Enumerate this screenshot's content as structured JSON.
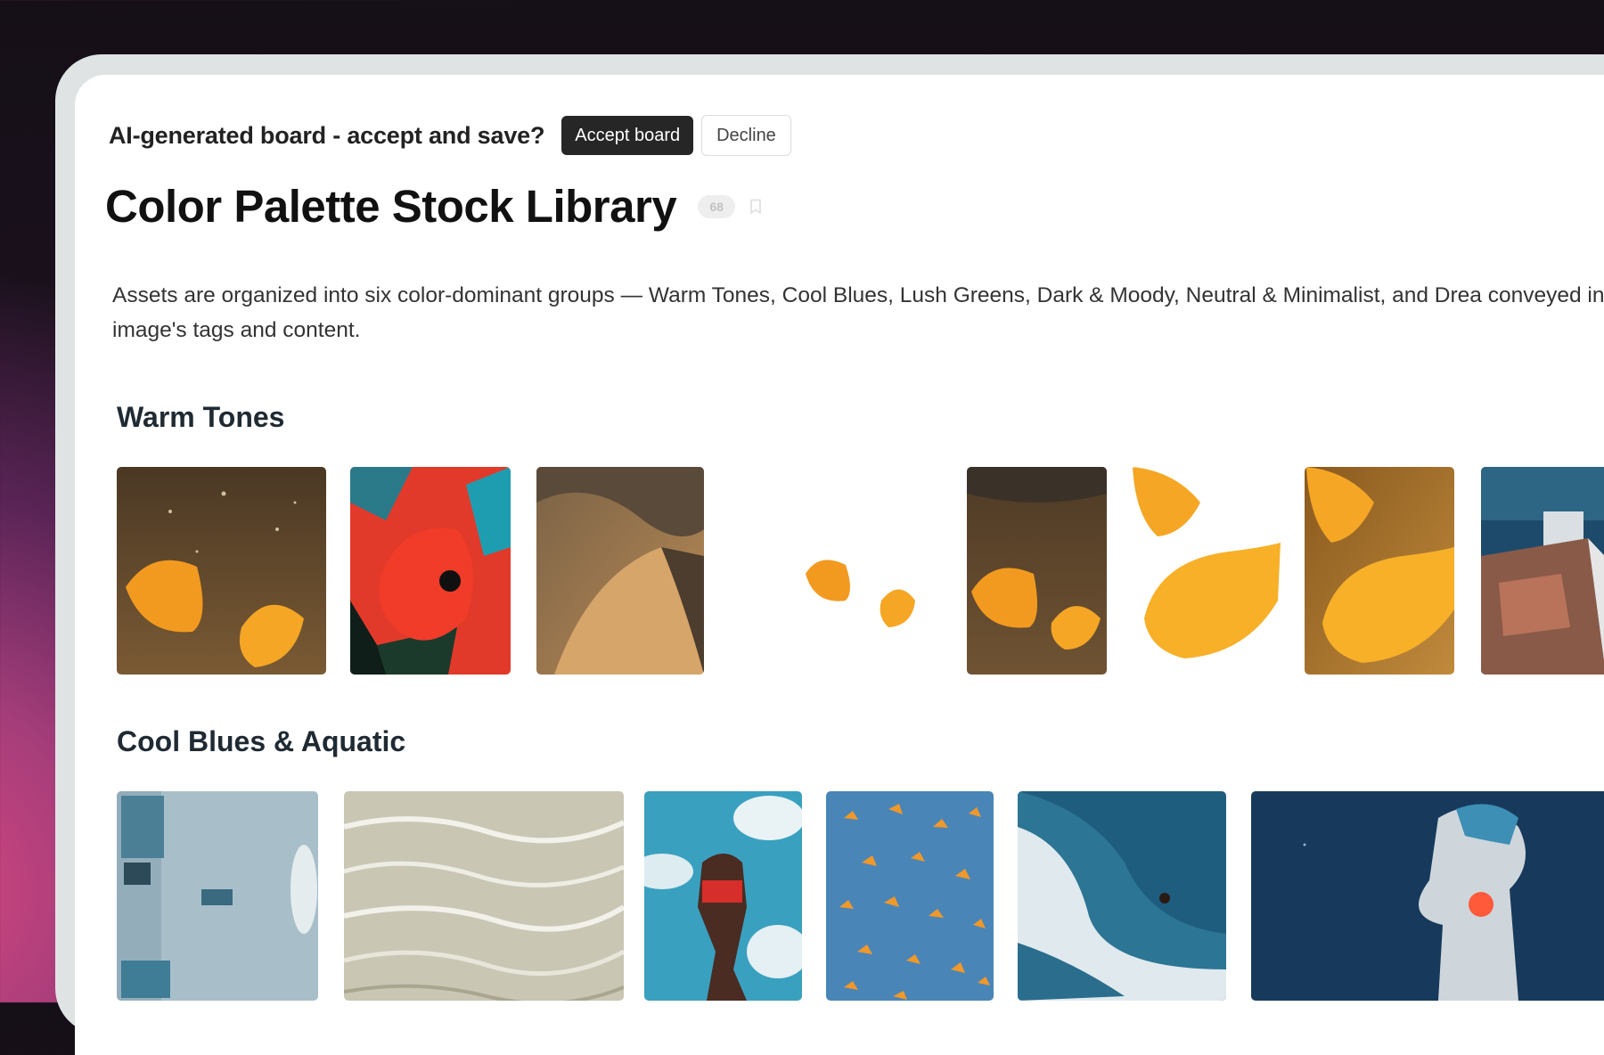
{
  "prompt": {
    "text": "AI-generated board - accept and save?",
    "accept_label": "Accept board",
    "decline_label": "Decline"
  },
  "board": {
    "title": "Color Palette Stock Library",
    "count": "68",
    "description": "Assets are organized into six color-dominant groups — Warm Tones, Cool Blues, Lush Greens, Dark & Moody, Neutral & Minimalist, and Drea conveyed in each image's tags and content."
  },
  "sections": [
    {
      "title": "Warm Tones",
      "images": [
        "oranges-underwater",
        "red-tulip",
        "sand-dunes",
        "orange-slices-cutout",
        "oranges-underwater-2",
        "orange-slices-cutout-2",
        "orange-slices-amber",
        "rooftop-terrace"
      ]
    },
    {
      "title": "Cool Blues & Aquatic",
      "images": [
        "misty-collage",
        "rippled-water",
        "low-angle-figure-sky",
        "monarch-butterflies",
        "surfer-wave",
        "anime-character-night"
      ]
    }
  ],
  "colors": {
    "accent_button": "#262626",
    "frame": "#dfe3e4"
  }
}
